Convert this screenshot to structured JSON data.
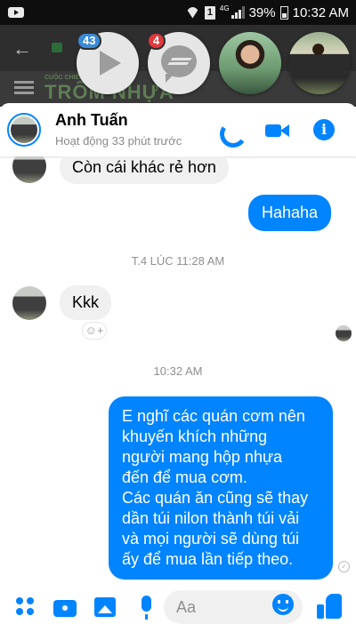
{
  "status_bar": {
    "sim_slot": "1",
    "network_type": "4G",
    "battery_percent": "39%",
    "time": "10:32 AM",
    "icons": [
      "youtube-icon",
      "wifi-icon",
      "signal-icon",
      "battery-icon"
    ]
  },
  "background_page": {
    "site_text": "TRÔM NHỰA",
    "site_small_text": "CUỘC CHIẾN",
    "icons": [
      "back-arrow-icon",
      "lock-icon",
      "menu-icon"
    ]
  },
  "chat_heads": [
    {
      "name": "video-chat-head",
      "badge": "43",
      "badge_color": "#3a8ad6"
    },
    {
      "name": "messenger-chat-head",
      "badge": "4",
      "badge_color": "#e0393e"
    },
    {
      "name": "contact-chat-head-1"
    },
    {
      "name": "contact-chat-head-2"
    }
  ],
  "conversation": {
    "name": "Anh Tuấn",
    "active_status": "Hoạt động 33 phút trước",
    "header_icons": [
      "phone-icon",
      "video-call-icon",
      "info-icon"
    ]
  },
  "messages": [
    {
      "type": "received",
      "text": "Còn cái khác rẻ hơn"
    },
    {
      "type": "sent",
      "text": "Hahaha"
    },
    {
      "type": "timestamp",
      "text": "T.4 LÚC 11:28 AM"
    },
    {
      "type": "received",
      "text": "Kkk"
    },
    {
      "type": "timestamp",
      "text": "10:32 AM"
    },
    {
      "type": "sent",
      "lines": [
        "E nghĩ các quán cơm nên",
        "khuyến khích những",
        "người mang hộp nhựa",
        "đến để mua cơm.",
        "Các quán ăn cũng sẽ thay",
        "dần túi nilon thành túi vải",
        "và mọi người sẽ dùng túi",
        "ấy để mua lần tiếp theo."
      ]
    }
  ],
  "reaction_button": {
    "label": "☺+"
  },
  "composer": {
    "placeholder": "Aa",
    "icons": [
      "more-icon",
      "camera-icon",
      "photo-icon",
      "mic-icon",
      "emoji-icon",
      "like-icon"
    ]
  },
  "colors": {
    "messenger_blue": "#0084ff",
    "received_bubble": "#f1f0f0",
    "timestamp_gray": "#8f8f8f"
  }
}
